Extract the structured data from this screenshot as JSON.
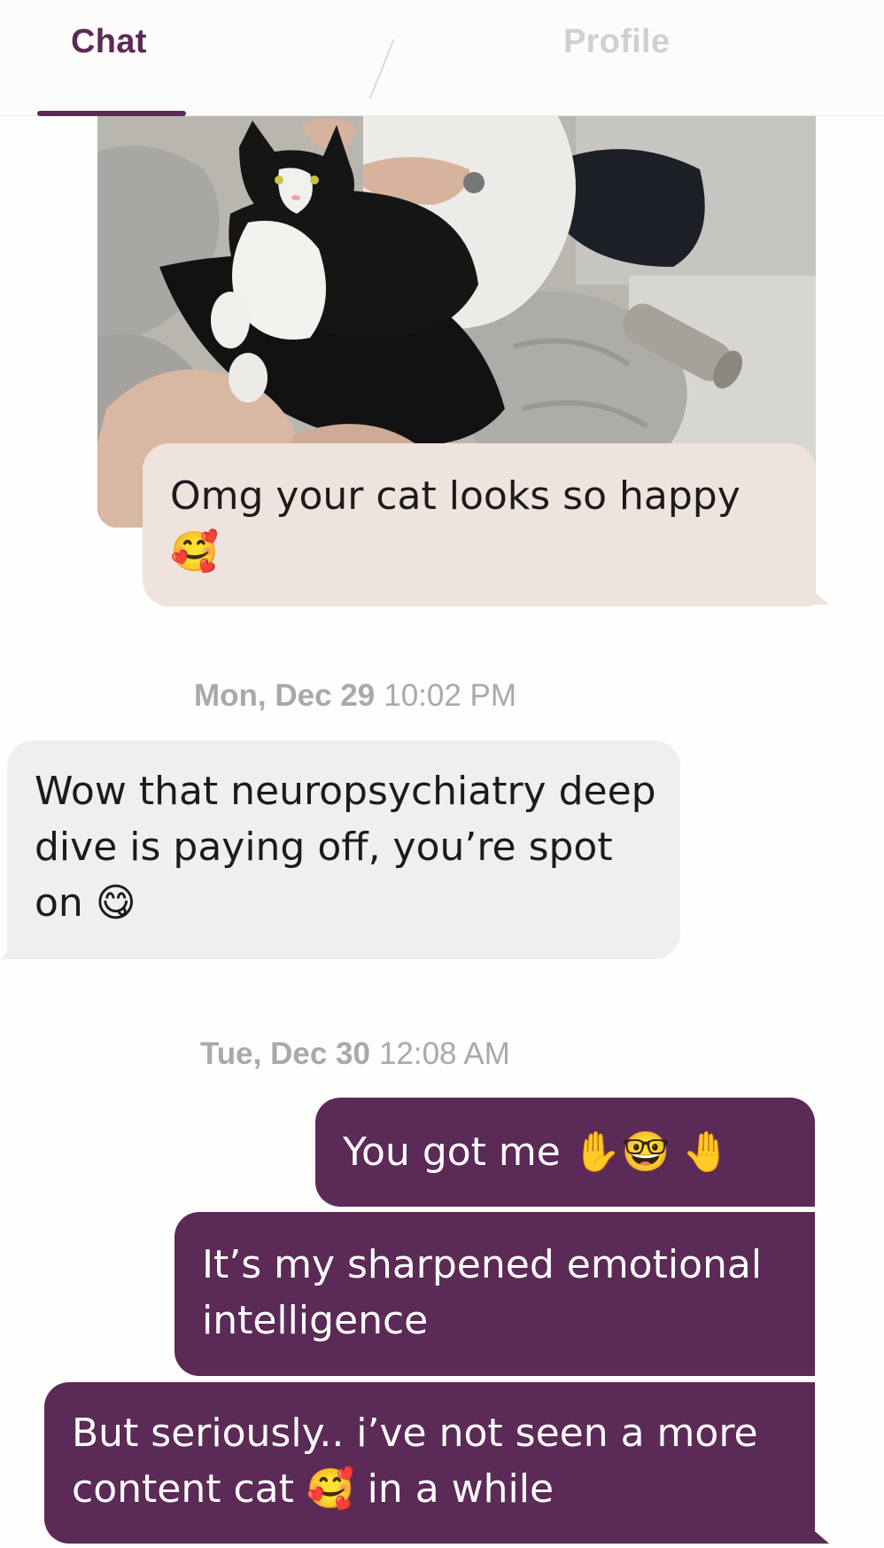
{
  "tabs": {
    "chat_label": "Chat",
    "profile_label": "Profile",
    "active": "Chat"
  },
  "colors": {
    "accent": "#5c2a57",
    "received_photo_bubble": "#efe3dd",
    "received_bubble": "#efefef",
    "timestamp": "#a9a9a9"
  },
  "photo_message": {
    "description_icon": "cat-photo",
    "reply_text": "Omg your cat looks so happy 🥰"
  },
  "messages": [
    {
      "timestamp_date": "Mon, Dec 29",
      "timestamp_time": "10:02 PM"
    },
    {
      "direction": "incoming",
      "text": "Wow that neuropsychiatry deep dive is paying off, you’re spot on 😋"
    },
    {
      "timestamp_date": "Tue, Dec 30",
      "timestamp_time": "12:08 AM"
    },
    {
      "direction": "outgoing",
      "text": "You got me ✋🤓 🤚"
    },
    {
      "direction": "outgoing",
      "text": "It’s my sharpened emotional intelligence"
    },
    {
      "direction": "outgoing",
      "text": "But seriously.. i’ve not seen a more content cat 🥰 in a while"
    }
  ]
}
